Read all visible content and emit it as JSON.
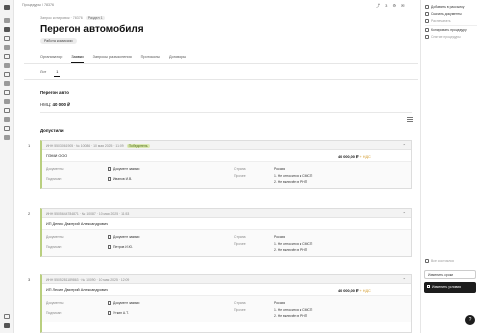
{
  "breadcrumbs": "Процедуры / 78376",
  "top_icons": "⤴ 3 ⚙ ✉",
  "sub_breadcrumb": "Запрос котировок · 78376",
  "sub_badge": "Раздел 1",
  "title": "Перегон автомобиля",
  "status": "Работа комиссии",
  "tabs": [
    {
      "label": "Организатор",
      "active": false
    },
    {
      "label": "Заявки",
      "active": true
    },
    {
      "label": "Запросы разъяснения",
      "active": false
    },
    {
      "label": "Протоколы",
      "active": false
    },
    {
      "label": "Договоры",
      "active": false
    }
  ],
  "subtabs": [
    {
      "label": "Лот",
      "active": false
    },
    {
      "label": "1",
      "active": true
    }
  ],
  "lot": {
    "heading": "Перегон авто",
    "nmc_label": "НМЦ:",
    "nmc_value": "40 000 ₽"
  },
  "admitted_heading": "Допустили",
  "participants": [
    {
      "num": "1",
      "meta": "ИНН 5503061905 · № 10086 · 10 мая 2025 · 11:09",
      "winner": "Победитель",
      "name": "ПЭМИ ООО",
      "price": "40 000,00 ₽",
      "vat": "+ НДС",
      "docs_label": "Документы",
      "docs_value": "Документ заявки",
      "signed_label": "Подписан",
      "signed_value": "Иванов И.В.",
      "country_label": "Страна",
      "country_value": "Россия",
      "other_label": "Прочее",
      "other_1": "1. Не относится к СМСП",
      "other_2": "2. Не включён в РНП"
    },
    {
      "num": "2",
      "meta": "ИНН 5505644784871 · № 10087 · 10 мая 2025 · 11:53",
      "winner": "",
      "name": "ИП Денис Дмитрий Александрович",
      "price": "",
      "vat": "",
      "docs_label": "Документы",
      "docs_value": "Документ заявки",
      "signed_label": "Подписан",
      "signed_value": "Петров И.Ю.",
      "country_label": "Страна",
      "country_value": "Россия",
      "other_label": "Прочее",
      "other_1": "1. Не относится к СМСП",
      "other_2": "2. Не включён в РНП"
    },
    {
      "num": "3",
      "meta": "ИНН 5505281189863 · № 10090 · 10 мая 2025 · 12:09",
      "winner": "",
      "name": "ИП Лесин Дмитрий Александрович",
      "price": "40 000,00 ₽",
      "vat": "+ НДС",
      "docs_label": "Документы",
      "docs_value": "Документ заявки",
      "signed_label": "Подписан",
      "signed_value": "Уткин А.Т.",
      "country_label": "Страна",
      "country_value": "Россия",
      "other_label": "Прочее",
      "other_1": "1. Не относится к СМСП",
      "other_2": "2. Не включён в РНП"
    }
  ],
  "right_panel": {
    "actions": [
      {
        "label": "Добавить в рассылку",
        "muted": false
      },
      {
        "label": "Скачать документы",
        "muted": false
      },
      {
        "label": "Распечатать",
        "muted": true
      },
      {
        "label": "Копировать процедуру",
        "muted": false
      },
      {
        "label": "Снятие процедуры",
        "muted": true
      }
    ],
    "decline_label": "Все состоялся",
    "outline_button": "Изменить сроки",
    "dark_button": "Изменить условия",
    "help": "?"
  }
}
